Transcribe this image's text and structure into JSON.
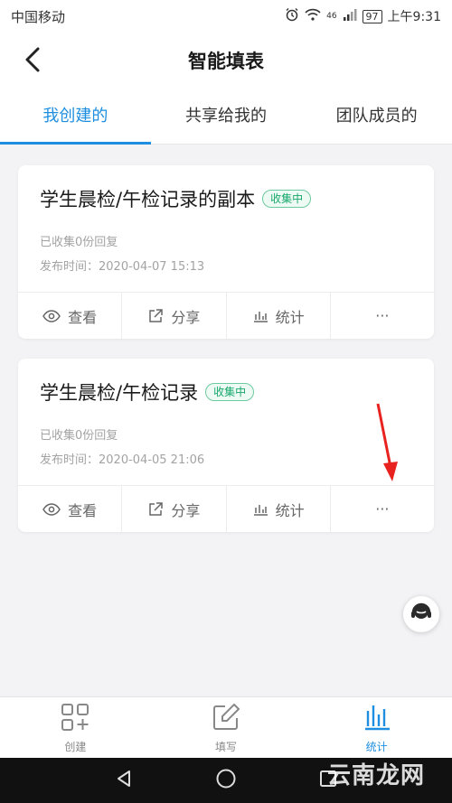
{
  "status_bar": {
    "carrier": "中国移动",
    "network": "46",
    "battery": "97",
    "time": "上午9:31"
  },
  "header": {
    "title": "智能填表",
    "back_icon": "chevron-left-icon"
  },
  "tabs": [
    {
      "label": "我创建的",
      "active": true
    },
    {
      "label": "共享给我的",
      "active": false
    },
    {
      "label": "团队成员的",
      "active": false
    }
  ],
  "forms": [
    {
      "title": "学生晨检/午检记录的副本",
      "badge": "收集中",
      "replies": "已收集0份回复",
      "published": "发布时间：2020-04-07 15:13"
    },
    {
      "title": "学生晨检/午检记录",
      "badge": "收集中",
      "replies": "已收集0份回复",
      "published": "发布时间：2020-04-05 21:06"
    }
  ],
  "card_actions": {
    "view": "查看",
    "share": "分享",
    "stats": "统计",
    "more": "···"
  },
  "bottom_nav": [
    {
      "label": "创建",
      "icon": "grid-plus-icon",
      "active": false
    },
    {
      "label": "填写",
      "icon": "edit-icon",
      "active": false
    },
    {
      "label": "统计",
      "icon": "bar-chart-icon",
      "active": true
    }
  ],
  "watermark": "云南龙网",
  "colors": {
    "accent": "#1e8fe0",
    "badge_green": "#17a86b",
    "annotation_red": "#e8231f"
  }
}
